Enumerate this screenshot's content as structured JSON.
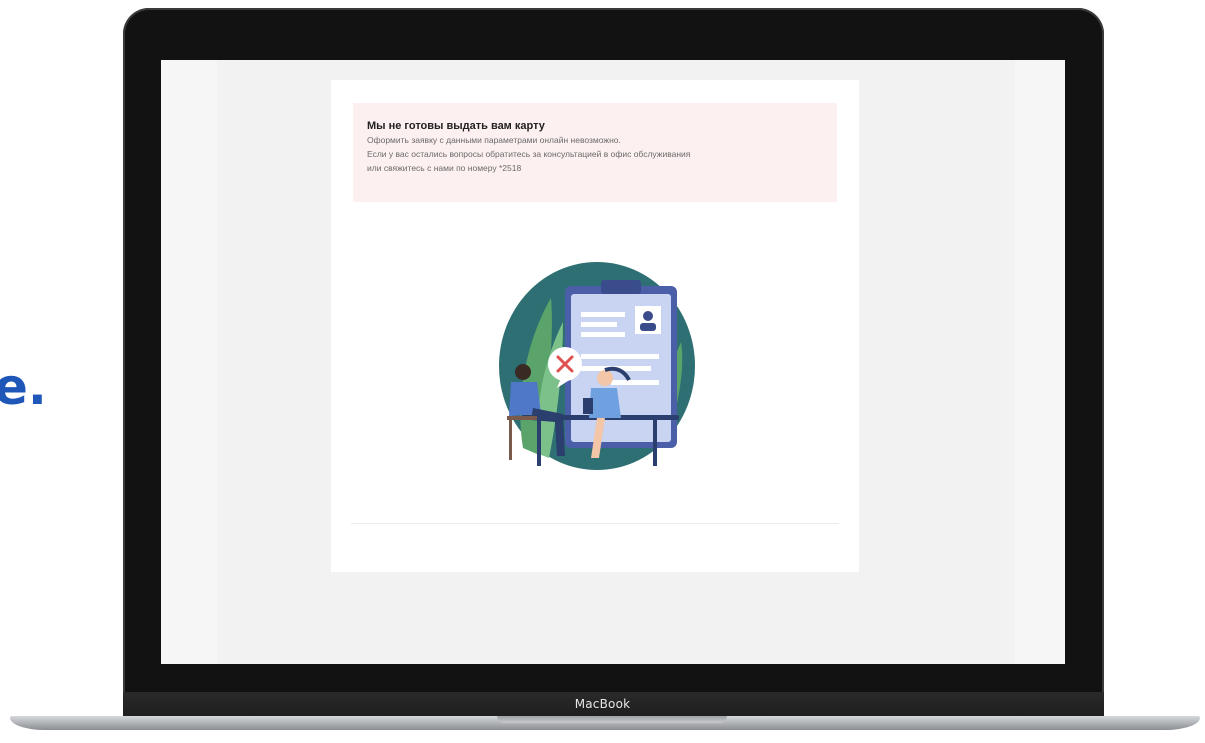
{
  "side_text": "e.",
  "device": {
    "brand_label": "MacBook"
  },
  "alert": {
    "title": "Мы не готовы выдать вам карту",
    "lines": [
      "Оформить заявку с данными параметрами онлайн невозможно.",
      "Если у вас остались вопросы обратитесь за консультацией в офис обслуживания",
      "или свяжитесь с нами по номеру *2518"
    ]
  },
  "colors": {
    "accent_blue": "#1f57b8",
    "alert_bg": "#fdf0f0",
    "illustration_teal": "#2e6f73",
    "error_red": "#e05050"
  },
  "icons": {
    "illustration": "rejected-application-illustration",
    "error_mark": "close-icon"
  }
}
